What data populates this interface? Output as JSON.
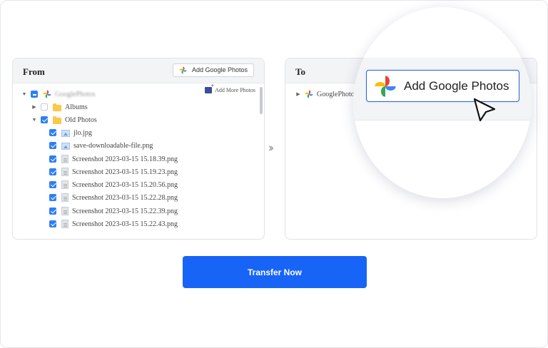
{
  "from_panel": {
    "title": "From",
    "add_button": "Add Google Photos",
    "add_more": "Add More Photos",
    "tree": [
      {
        "label": "GooglePhotos",
        "level": 0,
        "caret": "▼",
        "check": "partial",
        "icon": "google-photos-icon"
      },
      {
        "label": "Albums",
        "level": 1,
        "caret": "▶",
        "check": "off",
        "icon": "folder-icon"
      },
      {
        "label": "Old Photos",
        "level": 1,
        "caret": "▼",
        "check": "on",
        "icon": "folder-icon"
      },
      {
        "label": "jlo.jpg",
        "level": 2,
        "check": "on",
        "icon": "image-file-icon"
      },
      {
        "label": "save-downloadable-file.png",
        "level": 2,
        "check": "on",
        "icon": "image-file-icon"
      },
      {
        "label": "Screenshot 2023-03-15 15.18.39.png",
        "level": 2,
        "check": "on",
        "icon": "document-icon"
      },
      {
        "label": "Screenshot 2023-03-15 15.19.23.png",
        "level": 2,
        "check": "on",
        "icon": "document-icon"
      },
      {
        "label": "Screenshot 2023-03-15 15.20.56.png",
        "level": 2,
        "check": "on",
        "icon": "document-icon"
      },
      {
        "label": "Screenshot 2023-03-15 15.22.28.png",
        "level": 2,
        "check": "on",
        "icon": "document-icon"
      },
      {
        "label": "Screenshot 2023-03-15 15.22.39.png",
        "level": 2,
        "check": "on",
        "icon": "document-icon"
      },
      {
        "label": "Screenshot 2023-03-15 15.22.43.png",
        "level": 2,
        "check": "on",
        "icon": "document-icon"
      }
    ]
  },
  "to_panel": {
    "title": "To",
    "tree_root": "GooglePhotos",
    "zoomed_button": "Add Google Photos"
  },
  "transfer_button": "Transfer Now",
  "icons": {
    "separator": "double-chevron-right-icon",
    "cursor": "pointer-cursor-icon"
  },
  "colors": {
    "primary": "#1764f7",
    "checkbox": "#2f7ff4",
    "folder": "#fcc84b"
  }
}
